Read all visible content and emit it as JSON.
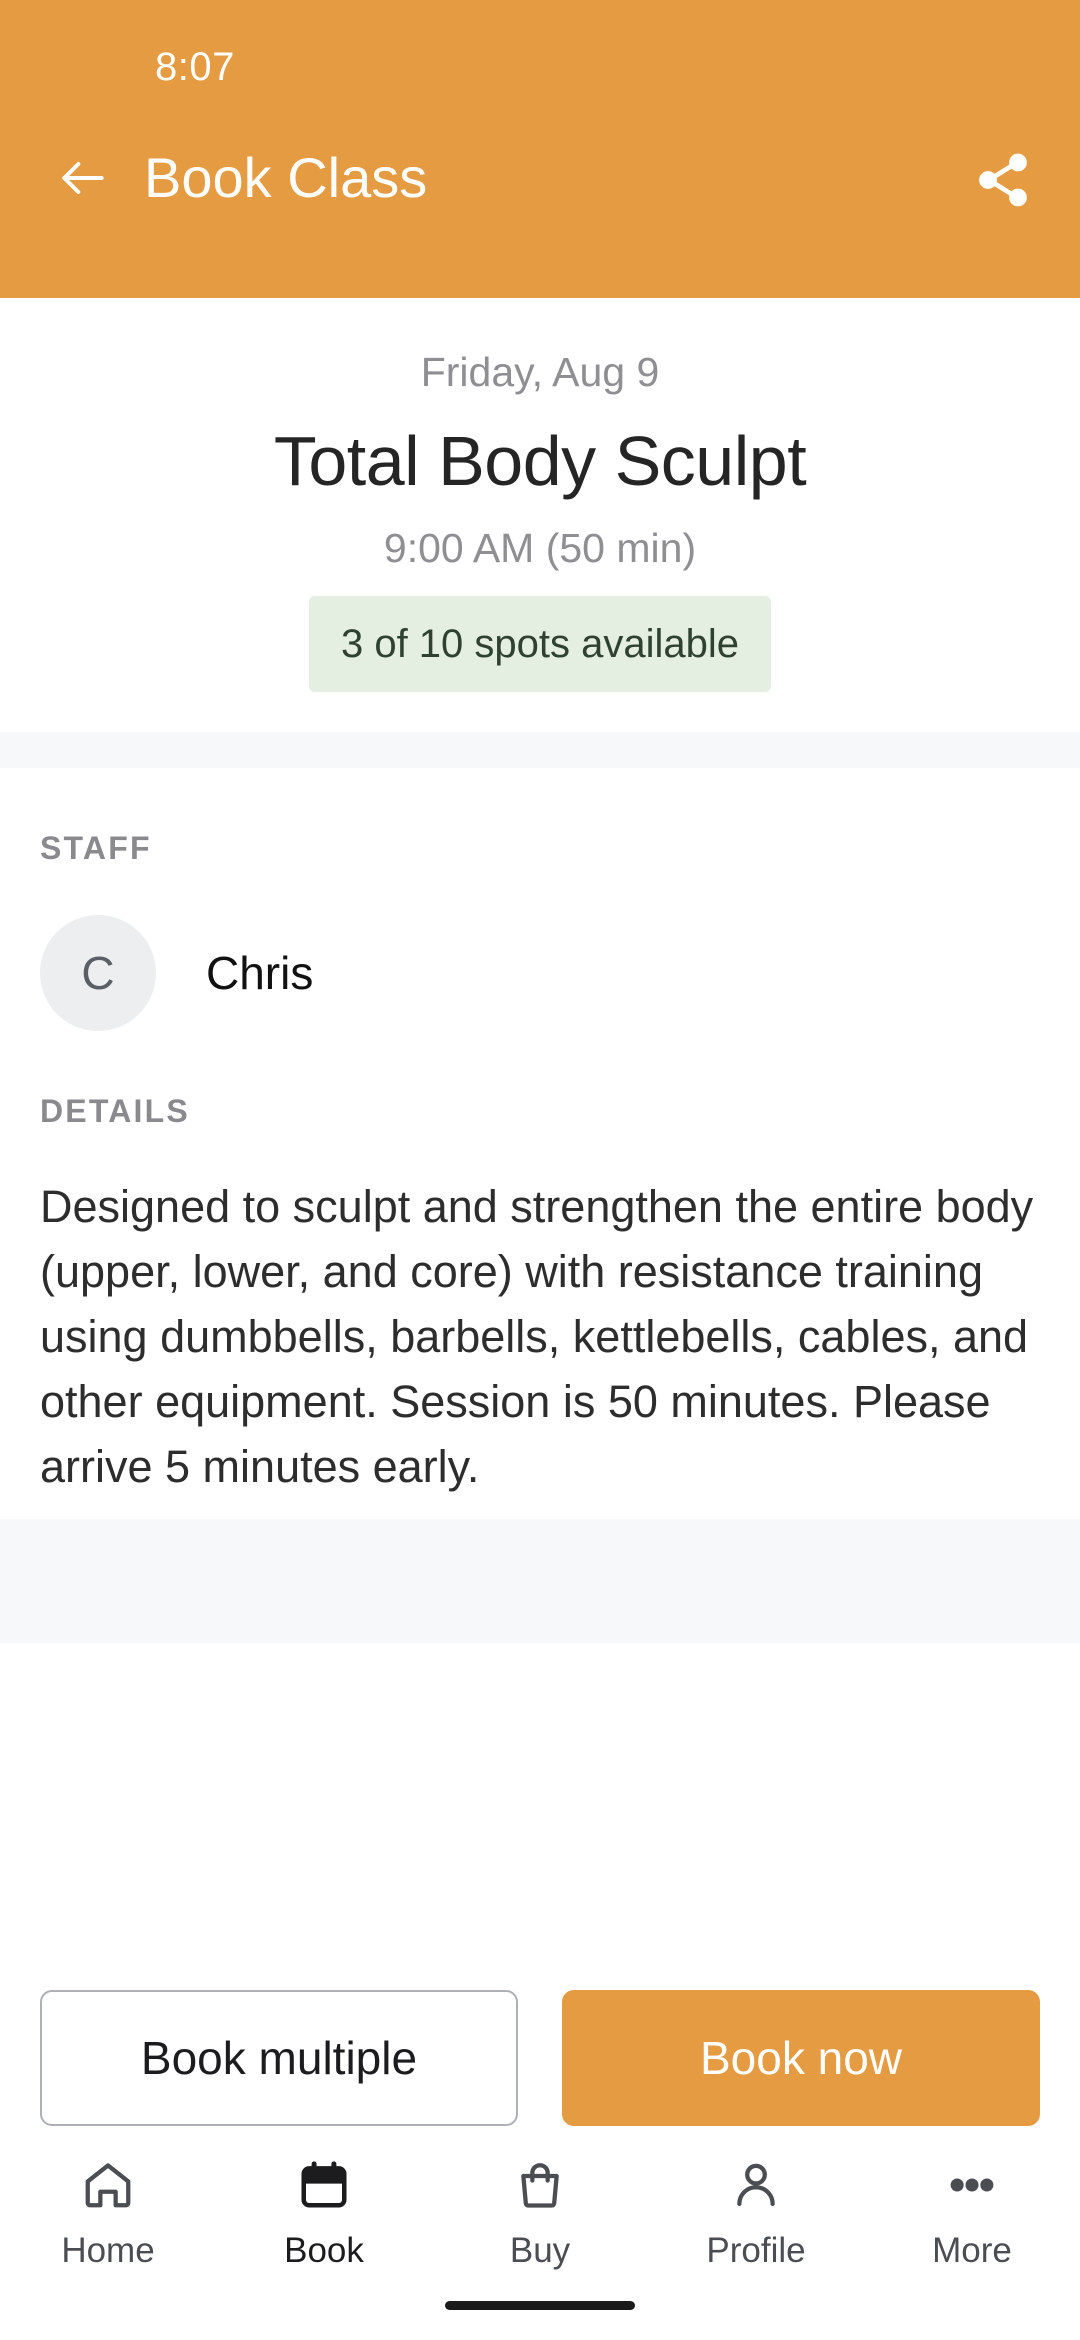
{
  "status_bar": {
    "time": "8:07"
  },
  "app_bar": {
    "title": "Book Class",
    "back_icon": "arrow-left-icon",
    "share_icon": "share-icon",
    "background_color": "#e49b42"
  },
  "hero": {
    "date": "Friday, Aug 9",
    "class_name": "Total Body Sculpt",
    "time": "9:00 AM (50 min)",
    "availability": "3 of 10 spots available",
    "availability_bg_color": "#e4efe1",
    "availability_text_color": "#2f4231"
  },
  "staff_section": {
    "label": "STAFF",
    "avatar_initial": "C",
    "name": "Chris"
  },
  "details_section": {
    "label": "DETAILS",
    "body": "Designed to sculpt and strengthen the entire body (upper, lower, and core) with resistance training using dumbbells, barbells, kettlebells, cables, and other equipment. Session is 50 minutes. Please arrive 5 minutes early."
  },
  "actions": {
    "secondary_label": "Book multiple",
    "primary_label": "Book now",
    "primary_color": "#e49b42"
  },
  "bottom_nav": {
    "items": [
      {
        "label": "Home",
        "icon": "home-icon",
        "active": false
      },
      {
        "label": "Book",
        "icon": "calendar-icon",
        "active": true
      },
      {
        "label": "Buy",
        "icon": "bag-icon",
        "active": false
      },
      {
        "label": "Profile",
        "icon": "person-icon",
        "active": false
      },
      {
        "label": "More",
        "icon": "ellipsis-icon",
        "active": false
      }
    ]
  }
}
